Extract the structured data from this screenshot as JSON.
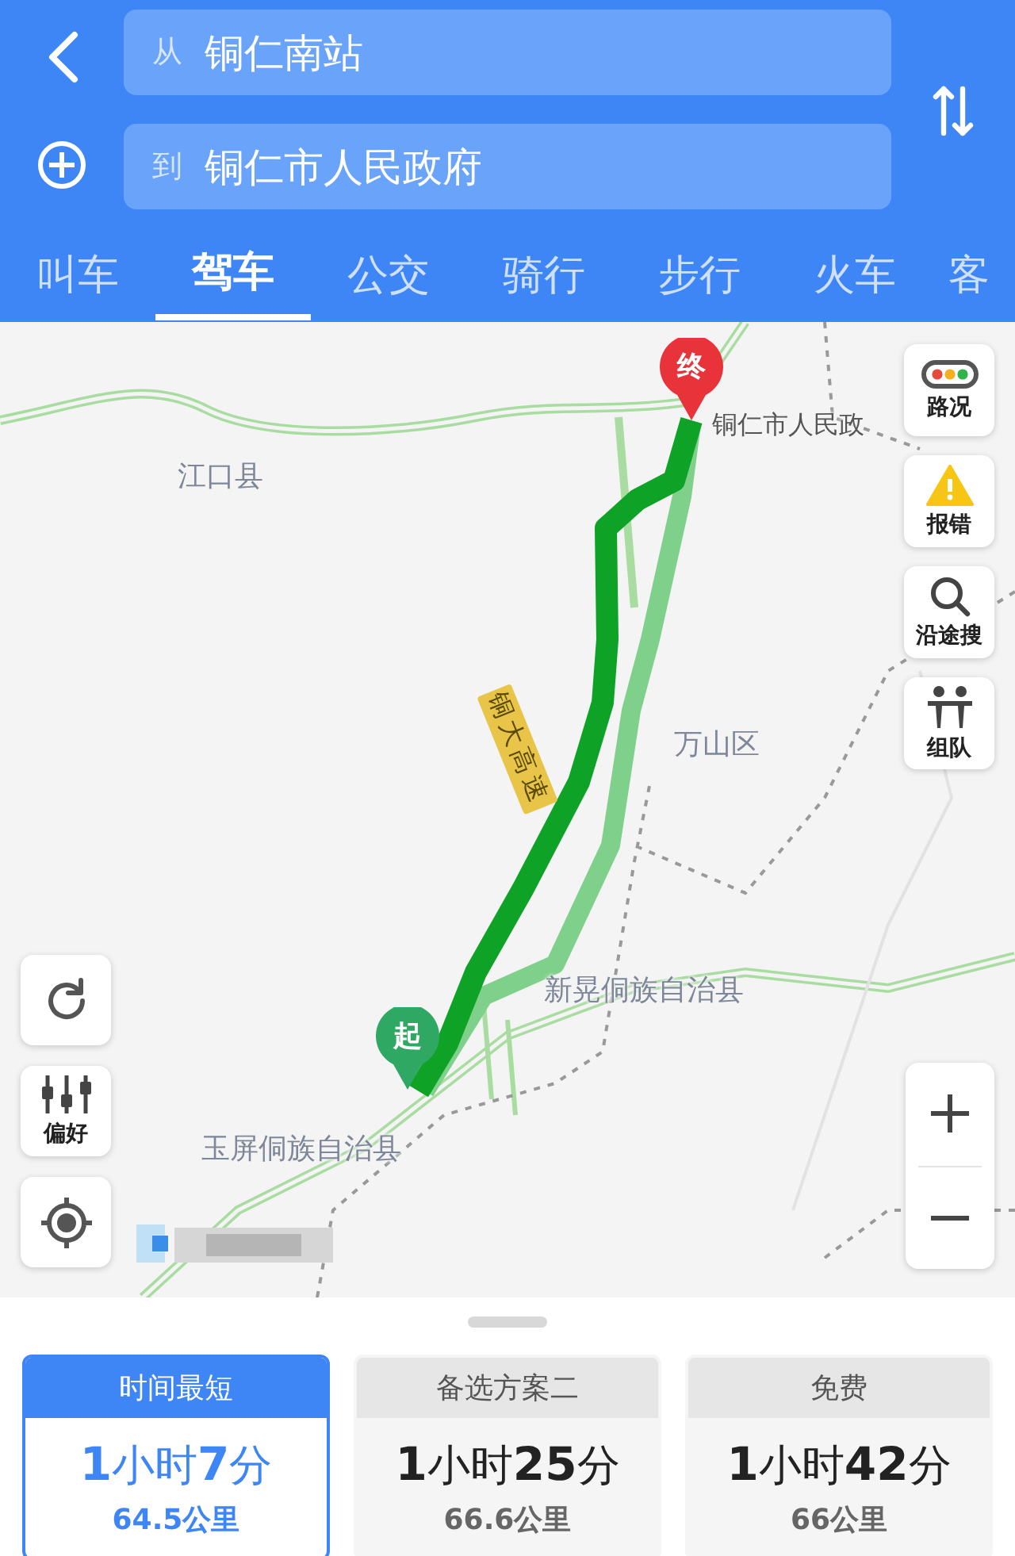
{
  "header": {
    "from": {
      "prefix": "从",
      "value": "铜仁南站"
    },
    "to": {
      "prefix": "到",
      "value": "铜仁市人民政府"
    }
  },
  "tabs": [
    {
      "label": "叫车",
      "selected": false
    },
    {
      "label": "驾车",
      "selected": true
    },
    {
      "label": "公交",
      "selected": false
    },
    {
      "label": "骑行",
      "selected": false
    },
    {
      "label": "步行",
      "selected": false
    },
    {
      "label": "火车",
      "selected": false
    },
    {
      "label": "客",
      "selected": false
    }
  ],
  "map": {
    "labels": [
      {
        "kind": "place",
        "text": "铜仁市人民政"
      },
      {
        "kind": "area",
        "text": "江口县"
      },
      {
        "kind": "area",
        "text": "万山区"
      },
      {
        "kind": "area",
        "text": "新晃侗族自治县"
      },
      {
        "kind": "area",
        "text": "玉屏侗族自治县"
      }
    ],
    "road_label": "铜大高速",
    "pins": [
      {
        "kind": "end",
        "label": "终"
      },
      {
        "kind": "start",
        "label": "起"
      }
    ],
    "right_tools": [
      {
        "kind": "traffic",
        "label": "路况"
      },
      {
        "kind": "report",
        "label": "报错"
      },
      {
        "kind": "search",
        "label": "沿途搜"
      },
      {
        "kind": "team",
        "label": "组队"
      }
    ],
    "left_tools": [
      {
        "kind": "refresh"
      },
      {
        "kind": "prefs",
        "label": "偏好"
      },
      {
        "kind": "locate"
      }
    ]
  },
  "routes": [
    {
      "title": "时间最短",
      "duration": "**1**小时**7**分",
      "distance": "64.5公里",
      "selected": true
    },
    {
      "title": "备选方案二",
      "duration": "**1**小时**25**分",
      "distance": "66.6公里",
      "selected": false
    },
    {
      "title": "免费",
      "duration": "**1**小时**42**分",
      "distance": "66公里",
      "selected": false
    }
  ]
}
